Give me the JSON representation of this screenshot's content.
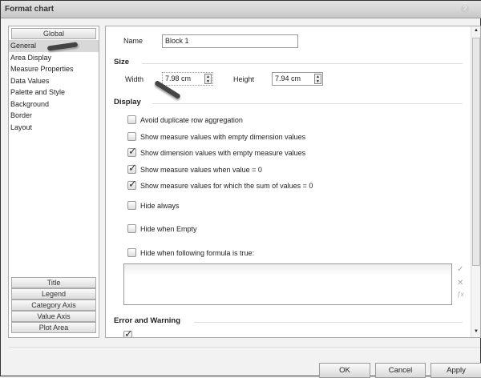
{
  "window": {
    "title": "Format chart",
    "help_icon": "help-icon"
  },
  "left": {
    "global": "Global",
    "items": [
      "General",
      "Area Display",
      "Measure Properties",
      "Data Values",
      "Palette and Style",
      "Background",
      "Border",
      "Layout"
    ],
    "selected": "General",
    "sections": [
      "Title",
      "Legend",
      "Category Axis",
      "Value Axis",
      "Plot Area"
    ]
  },
  "general": {
    "name_label": "Name",
    "name_value": "Block 1",
    "size_title": "Size",
    "width_label": "Width",
    "width_value": "7.98 cm",
    "height_label": "Height",
    "height_value": "7.94 cm",
    "display_title": "Display",
    "options": [
      {
        "label": "Avoid duplicate row aggregation",
        "checked": false
      },
      {
        "label": "Show measure values with empty dimension values",
        "checked": false
      },
      {
        "label": "Show dimension values with empty measure values",
        "checked": true
      },
      {
        "label": "Show measure values when value = 0",
        "checked": true
      },
      {
        "label": "Show measure values for which the sum of values = 0",
        "checked": true
      },
      {
        "label": "Hide always",
        "checked": false
      },
      {
        "label": "Hide when Empty",
        "checked": false
      },
      {
        "label": "Hide when following formula is true:",
        "checked": false
      }
    ],
    "error_title": "Error and Warning"
  },
  "buttons": {
    "ok": "OK",
    "cancel": "Cancel",
    "apply": "Apply"
  }
}
